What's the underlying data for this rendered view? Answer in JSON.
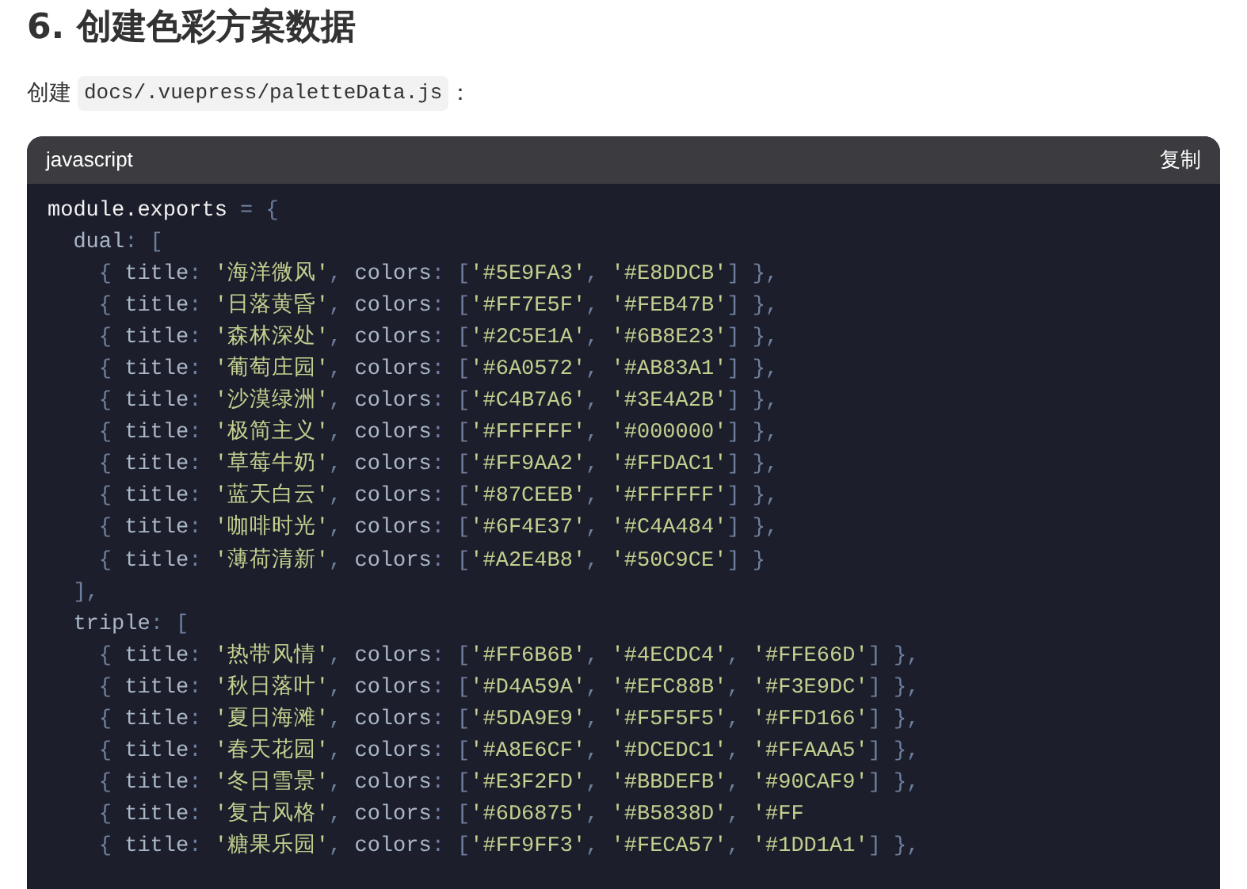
{
  "heading": "6. 创建色彩方案数据",
  "intro": {
    "text": "创建",
    "path": "docs/.vuepress/paletteData.js",
    "suffix": "："
  },
  "code_block": {
    "language": "javascript",
    "copy_label": "复制",
    "lines": [
      "module.exports = {",
      "  dual: [",
      "    { title: '海洋微风', colors: ['#5E9FA3', '#E8DDCB'] },",
      "    { title: '日落黄昏', colors: ['#FF7E5F', '#FEB47B'] },",
      "    { title: '森林深处', colors: ['#2C5E1A', '#6B8E23'] },",
      "    { title: '葡萄庄园', colors: ['#6A0572', '#AB83A1'] },",
      "    { title: '沙漠绿洲', colors: ['#C4B7A6', '#3E4A2B'] },",
      "    { title: '极简主义', colors: ['#FFFFFF', '#000000'] },",
      "    { title: '草莓牛奶', colors: ['#FF9AA2', '#FFDAC1'] },",
      "    { title: '蓝天白云', colors: ['#87CEEB', '#FFFFFF'] },",
      "    { title: '咖啡时光', colors: ['#6F4E37', '#C4A484'] },",
      "    { title: '薄荷清新', colors: ['#A2E4B8', '#50C9CE'] }",
      "  ],",
      "  triple: [",
      "    { title: '热带风情', colors: ['#FF6B6B', '#4ECDC4', '#FFE66D'] },",
      "    { title: '秋日落叶', colors: ['#D4A59A', '#EFC88B', '#F3E9DC'] },",
      "    { title: '夏日海滩', colors: ['#5DA9E9', '#F5F5F5', '#FFD166'] },",
      "    { title: '春天花园', colors: ['#A8E6CF', '#DCEDC1', '#FFAAA5'] },",
      "    { title: '冬日雪景', colors: ['#E3F2FD', '#BBDEFB', '#90CAF9'] },",
      "    { title: '复古风格', colors: ['#6D6875', '#B5838D', '#FF",
      "    { title: '糖果乐园', colors: ['#FF9FF3', '#FECA57', '#1DD1A1'] },"
    ]
  }
}
